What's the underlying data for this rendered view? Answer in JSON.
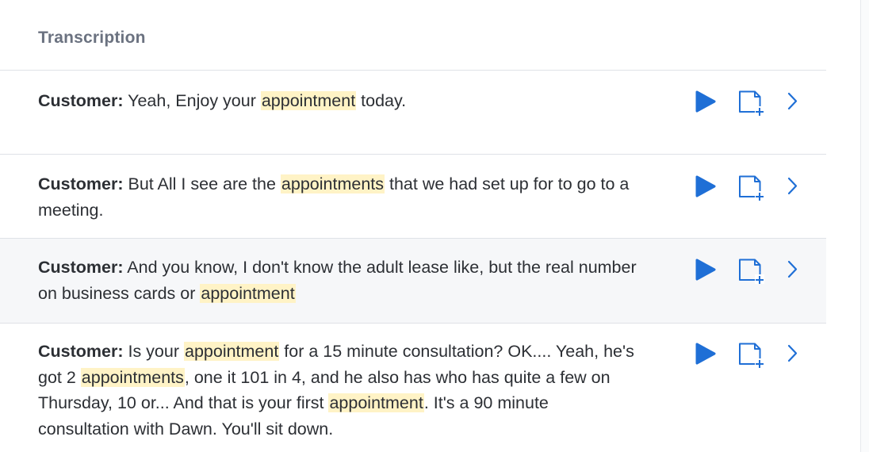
{
  "panel": {
    "title": "Transcription"
  },
  "rows": [
    {
      "speaker": "Customer:",
      "segments": [
        {
          "text": " Yeah, Enjoy your ",
          "highlight": false
        },
        {
          "text": "appointment",
          "highlight": true
        },
        {
          "text": " today.",
          "highlight": false
        }
      ]
    },
    {
      "speaker": "Customer:",
      "segments": [
        {
          "text": " But All I see are the ",
          "highlight": false
        },
        {
          "text": "appointments",
          "highlight": true
        },
        {
          "text": " that we had set up for to go to a meeting.",
          "highlight": false
        }
      ]
    },
    {
      "speaker": "Customer:",
      "segments": [
        {
          "text": " And you know, I don't know the adult lease like, but the real number on business cards or ",
          "highlight": false
        },
        {
          "text": "appointment",
          "highlight": true
        }
      ]
    },
    {
      "speaker": "Customer:",
      "segments": [
        {
          "text": " Is your ",
          "highlight": false
        },
        {
          "text": "appointment",
          "highlight": true
        },
        {
          "text": " for a 15 minute consultation? OK.... Yeah, he's got 2 ",
          "highlight": false
        },
        {
          "text": "appointments",
          "highlight": true
        },
        {
          "text": ", one it 101 in 4, and he also has who has quite a few on Thursday, 10 or... And that is your first ",
          "highlight": false
        },
        {
          "text": "appointment",
          "highlight": true
        },
        {
          "text": ". It's a 90 minute consultation with Dawn. You'll sit down.",
          "highlight": false
        }
      ]
    }
  ],
  "icons": {
    "play": "play-icon",
    "note": "add-note-icon",
    "expand": "chevron-right-icon"
  },
  "colors": {
    "accent": "#1f6fd6",
    "highlight": "#fff3c6",
    "row_alt_bg": "#f6f7f9",
    "divider": "#dfe2e7",
    "title": "#6b7280",
    "text": "#2c2f34"
  }
}
